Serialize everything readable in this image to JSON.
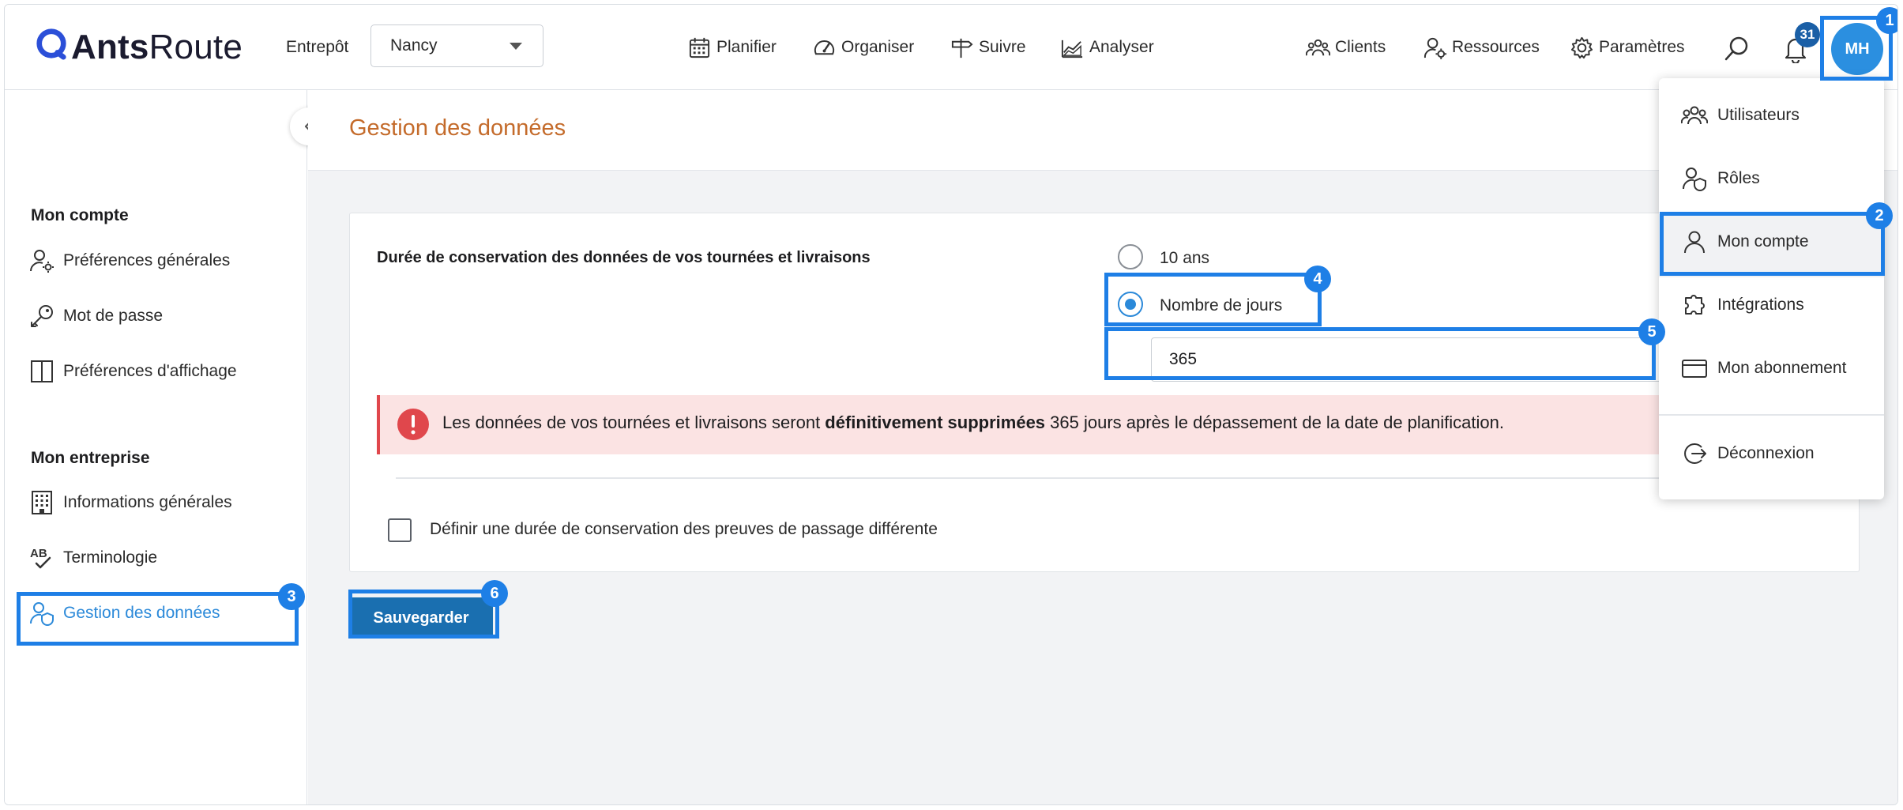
{
  "header": {
    "logo": {
      "part1": "Ants",
      "part2": "Route",
      "icon": "antsroute-logo-icon"
    },
    "warehouse_label": "Entrepôt",
    "warehouse_value": "Nancy",
    "nav": [
      {
        "label": "Planifier",
        "icon": "calendar-icon"
      },
      {
        "label": "Organiser",
        "icon": "gauge-icon"
      },
      {
        "label": "Suivre",
        "icon": "signpost-icon"
      },
      {
        "label": "Analyser",
        "icon": "chart-icon"
      }
    ],
    "right_nav": [
      {
        "label": "Clients",
        "icon": "group-icon"
      },
      {
        "label": "Ressources",
        "icon": "user-gear-icon"
      },
      {
        "label": "Paramètres",
        "icon": "gear-icon"
      }
    ],
    "notifications_count": "31",
    "avatar_initials": "MH"
  },
  "sidebar": {
    "account_title": "Mon compte",
    "account_items": [
      {
        "label": "Préférences générales",
        "icon": "user-settings-icon"
      },
      {
        "label": "Mot de passe",
        "icon": "key-icon"
      },
      {
        "label": "Préférences d'affichage",
        "icon": "layout-columns-icon"
      }
    ],
    "company_title": "Mon entreprise",
    "company_items": [
      {
        "label": "Informations générales",
        "icon": "building-icon"
      },
      {
        "label": "Terminologie",
        "icon": "spellcheck-icon"
      },
      {
        "label": "Gestion des données",
        "icon": "user-shield-icon"
      }
    ]
  },
  "main": {
    "page_title": "Gestion des données",
    "retention_label": "Durée de conservation des données de vos tournées et livraisons",
    "option_years": "10 ans",
    "option_days": "Nombre de jours",
    "days_value": "365",
    "alert": {
      "before": "Les données de vos tournées et livraisons seront ",
      "bold": "définitivement supprimées",
      "after": " 365 jours après le dépassement de la date de planification."
    },
    "checkbox_label": "Définir une durée de conservation des preuves de passage différente",
    "save_label": "Sauvegarder"
  },
  "dropdown": {
    "items": [
      {
        "label": "Utilisateurs",
        "icon": "users-icon"
      },
      {
        "label": "Rôles",
        "icon": "user-shield-icon"
      },
      {
        "label": "Mon compte",
        "icon": "user-icon"
      },
      {
        "label": "Intégrations",
        "icon": "puzzle-icon"
      },
      {
        "label": "Mon abonnement",
        "icon": "credit-card-icon"
      },
      {
        "label": "Déconnexion",
        "icon": "logout-icon"
      }
    ]
  },
  "annotations": [
    "1",
    "2",
    "3",
    "4",
    "5",
    "6"
  ],
  "colors": {
    "accent": "#1e7fe6",
    "title_orange": "#c46b2b",
    "active_blue": "#2b89d9",
    "alert_bg": "#fbe3e3",
    "alert_red": "#e0474c",
    "save_button": "#1a6fb0"
  }
}
